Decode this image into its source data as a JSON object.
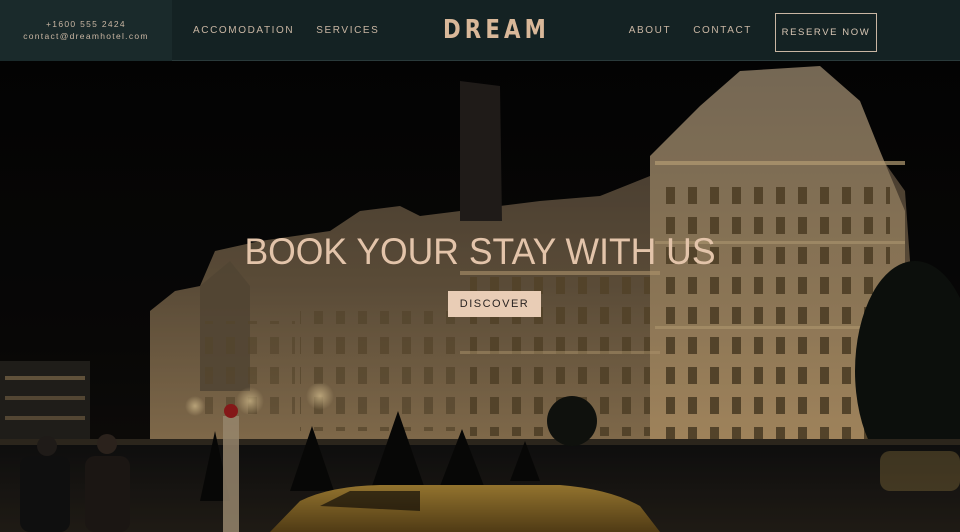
{
  "header": {
    "phone": "+1600 555 2424",
    "email": "contact@dreamhotel.com",
    "nav_left": [
      "ACCOMODATION",
      "SERVICES"
    ],
    "logo": "DREAM",
    "nav_right": [
      "ABOUT",
      "CONTACT"
    ],
    "reserve_label": "RESERVE NOW"
  },
  "hero": {
    "title": "BOOK YOUR STAY WITH US",
    "cta_label": "DISCOVER",
    "background_image": "night-photo-of-illuminated-historic-building"
  },
  "colors": {
    "header_bg": "#142223",
    "accent": "#d9b899",
    "cta_bg": "#e9cdb6"
  }
}
